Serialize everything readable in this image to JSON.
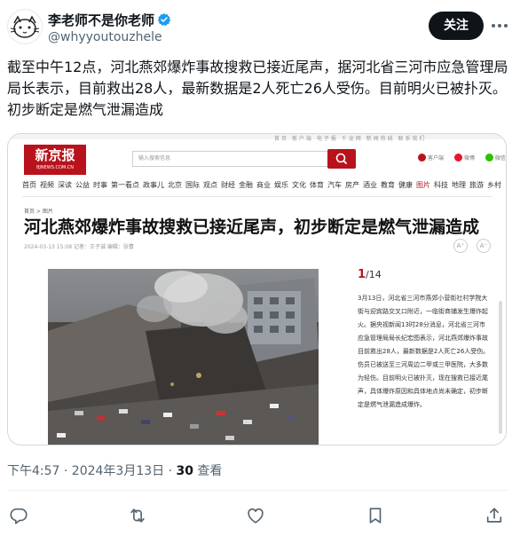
{
  "author": {
    "display_name": "李老师不是你老师",
    "handle": "@whyyoutouzhele",
    "verified": true
  },
  "follow_button": {
    "label": "关注"
  },
  "icons": {
    "more": "more-dots-icon",
    "reply": "reply-icon",
    "retweet": "retweet-icon",
    "like": "heart-icon",
    "bookmark": "bookmark-icon",
    "share": "share-icon"
  },
  "tweet": {
    "text": "截至中午12点，河北燕郊爆炸事故搜救已接近尾声，据河北省三河市应急管理局局长表示，目前救出28人，最新数据是2人死亡26人受伤。目前明火已被扑灭。初步断定是燃气泄漏造成"
  },
  "embedded_page": {
    "logo": {
      "main": "新京报",
      "sub": "BJNEWS.COM.CN"
    },
    "top_links": "首页 客户端 电子报 千龙网 新闻热线 联系我们",
    "search_placeholder": "输入搜索信息",
    "social": [
      "客户端",
      "微博",
      "微信"
    ],
    "nav": [
      "首页",
      "视频",
      "深读",
      "公益",
      "时事",
      "第一看点",
      "政事儿",
      "北京",
      "国际",
      "观点",
      "财经",
      "金融",
      "商业",
      "娱乐",
      "文化",
      "体育",
      "汽车",
      "房产",
      "酒业",
      "教育",
      "健康",
      "图片",
      "科技",
      "地理",
      "旅游",
      "乡村"
    ],
    "nav_active": "图片",
    "breadcrumb": "首页 > 图片",
    "headline": "河北燕郊爆炸事故搜救已接近尾声，初步断定是燃气泄漏造成",
    "meta": "2024-03-13 15:08   记者：王子诚   编辑：张曹",
    "font_buttons": [
      "A⁺",
      "A⁻"
    ],
    "pager": {
      "current": "1",
      "total": "/14"
    },
    "caption": "3月13日，河北省三河市燕郊小营街社村学院大街与迎宾路交叉口附近，一临街商铺发生爆炸起火。据央视新闻13时28分消息，河北省三河市应急管理局局长纪宏图表示，河北燕郊爆炸事故目前救出28人，最新数据是2人死亡26人受伤。伤员已被送至三河周边二甲或三甲医院，大多数为轻伤。目前明火已被扑灭，现在搜救已接近尾声，具体爆炸原因和具体地点尚未确定，初步断定是燃气泄漏造成爆炸。",
    "accent_color": "#b8131c"
  },
  "timestamp": {
    "time": "下午4:57 · 2024年3月13日 · ",
    "views_count": "30",
    "views_label": " 查看"
  }
}
